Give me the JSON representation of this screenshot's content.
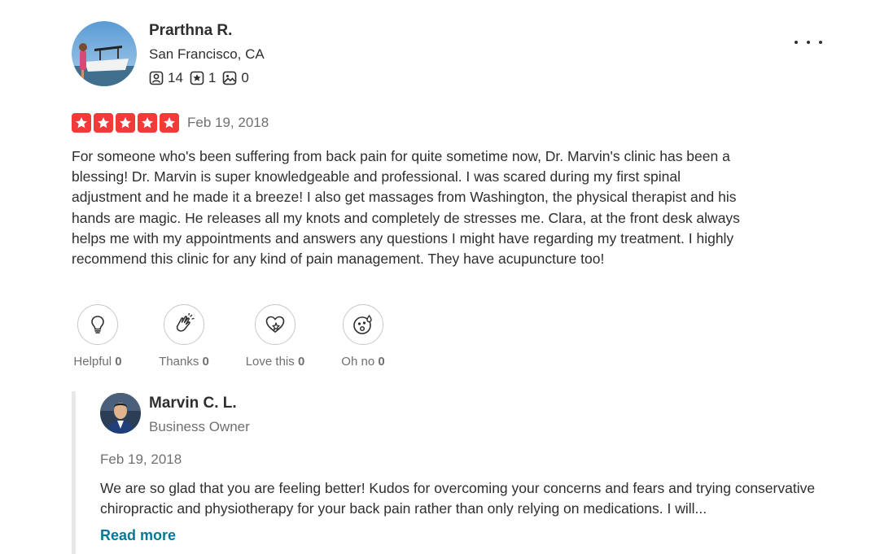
{
  "review": {
    "user": {
      "name": "Prarthna R.",
      "location": "San Francisco, CA",
      "stats": {
        "friends": "14",
        "reviews": "1",
        "photos": "0"
      }
    },
    "rating": 5,
    "date": "Feb 19, 2018",
    "text": "For someone who's been suffering from back pain for quite sometime now, Dr. Marvin's clinic has been a blessing! Dr. Marvin is super knowledgeable and professional. I was scared during my first spinal adjustment and he made it a breeze! I also get massages from Washington, the physical therapist and his hands are magic. He releases all my knots and completely de stresses me. Clara, at the front desk always helps me with my appointments and answers any questions I might have regarding my treatment. I highly recommend this clinic for any kind of pain management. They have acupuncture too!"
  },
  "reactions": [
    {
      "label": "Helpful",
      "count": "0",
      "icon": "lightbulb-icon"
    },
    {
      "label": "Thanks",
      "count": "0",
      "icon": "clapping-hands-icon"
    },
    {
      "label": "Love this",
      "count": "0",
      "icon": "heart-icon"
    },
    {
      "label": "Oh no",
      "count": "0",
      "icon": "shocked-face-icon"
    }
  ],
  "reply": {
    "name": "Marvin C. L.",
    "role": "Business Owner",
    "date": "Feb 19, 2018",
    "text": "We are so glad that you are feeling better! Kudos for overcoming your concerns and fears and trying conservative chiropractic and physiotherapy for your back pain rather than only relying on medications. I will...",
    "read_more": "Read more"
  },
  "colors": {
    "star": "#f43939",
    "link": "#027a97",
    "muted": "#6e7072",
    "text": "#2d2e2f"
  }
}
